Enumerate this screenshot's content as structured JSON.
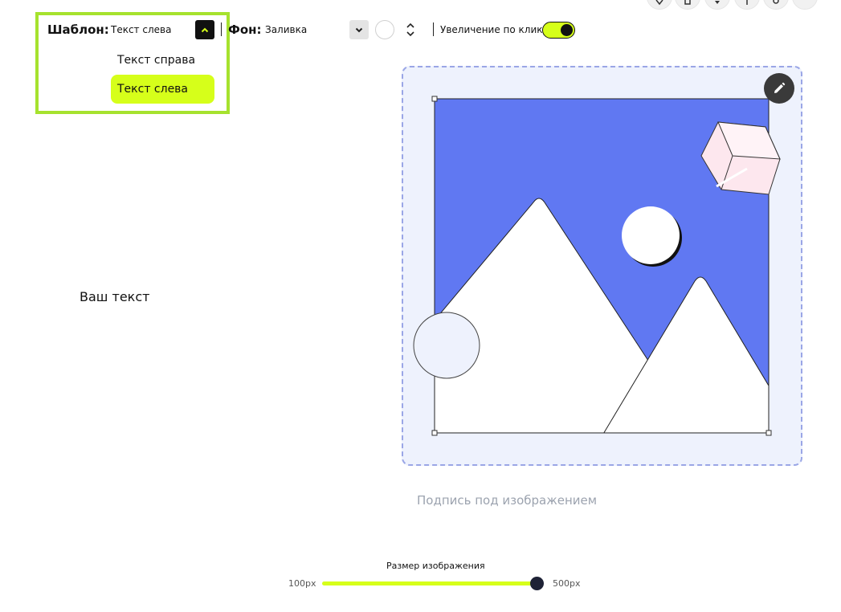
{
  "toolbar": {
    "template_label": "Шаблон:",
    "template_value": "Текст слева",
    "template_options": [
      "Текст справа",
      "Текст слева"
    ],
    "background_label": "Фон:",
    "background_value": "Заливка",
    "zoom_on_click_label": "Увеличение по клику",
    "zoom_on_click_enabled": true
  },
  "content": {
    "text_placeholder": "Ваш текст",
    "caption_placeholder": "Подпись под изображением"
  },
  "image_size": {
    "label": "Размер изображения",
    "min": "100px",
    "max": "500px",
    "value_fraction": 1.0
  },
  "colors": {
    "accent": "#d6ff1a",
    "highlight_border": "#a6e22e",
    "image_sky": "#6078f2",
    "drop_zone_bg": "#eef2fd",
    "drop_zone_border": "#9aa6e6"
  },
  "icons": {
    "dropdown_open": "chevron-up-icon",
    "dropdown_closed": "chevron-down-icon",
    "stepper": "chevron-up-down-icon",
    "edit": "pencil-icon"
  }
}
